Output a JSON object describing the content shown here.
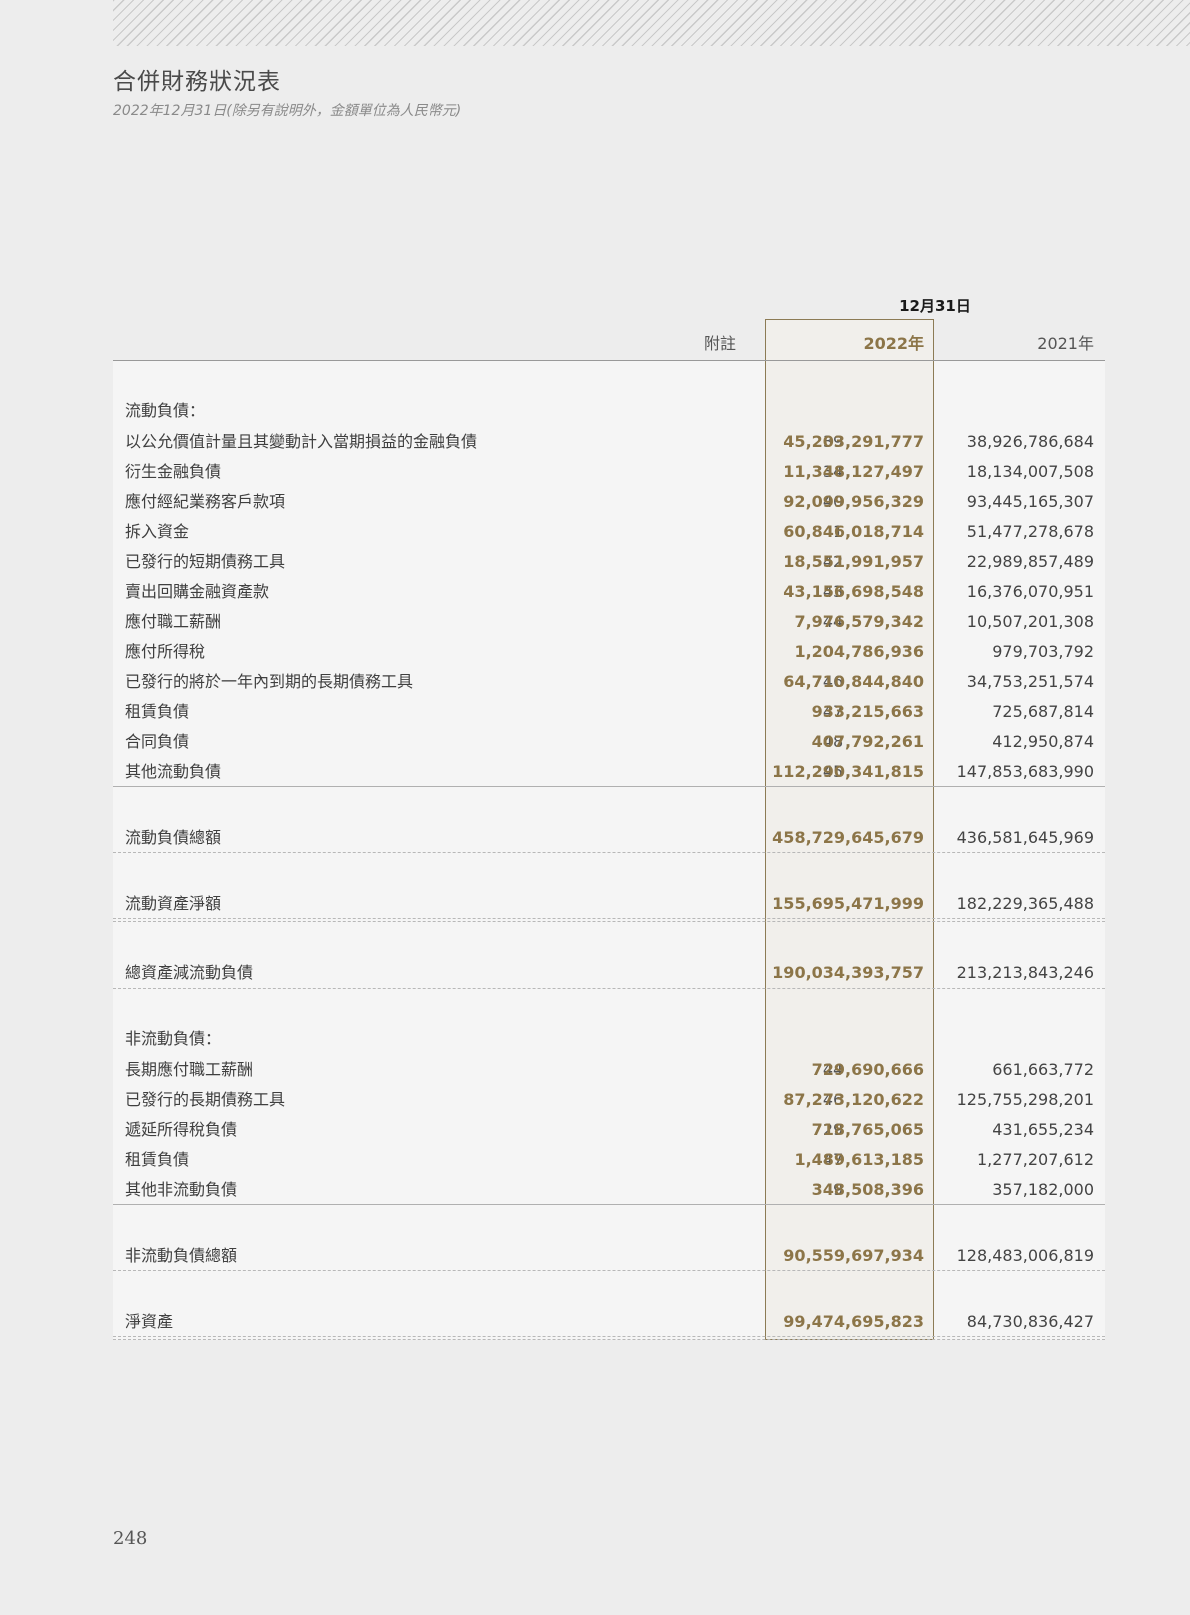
{
  "header": {
    "title": "合併財務狀況表",
    "subtitle": "2022年12月31日(除另有說明外，金額單位為人民幣元)"
  },
  "table": {
    "date_label": "12月31日",
    "note_header": "附註",
    "year_current": "2022年",
    "year_prior": "2021年",
    "current_liabilities_heading": "流動負債：",
    "current_liabilities": [
      {
        "label": "以公允價值計量且其變動計入當期損益的金融負債",
        "note": "39",
        "y2022": "45,203,291,777",
        "y2021": "38,926,786,684"
      },
      {
        "label": "衍生金融負債",
        "note": "34",
        "y2022": "11,348,127,497",
        "y2021": "18,134,007,508"
      },
      {
        "label": "應付經紀業務客戶款項",
        "note": "40",
        "y2022": "92,099,956,329",
        "y2021": "93,445,165,307"
      },
      {
        "label": "拆入資金",
        "note": "41",
        "y2022": "60,846,018,714",
        "y2021": "51,477,278,678"
      },
      {
        "label": "已發行的短期債務工具",
        "note": "42",
        "y2022": "18,551,991,957",
        "y2021": "22,989,857,489"
      },
      {
        "label": "賣出回購金融資產款",
        "note": "43",
        "y2022": "43,156,698,548",
        "y2021": "16,376,070,951"
      },
      {
        "label": "應付職工薪酬",
        "note": "44",
        "y2022": "7,976,579,342",
        "y2021": "10,507,201,308"
      },
      {
        "label": "應付所得稅",
        "note": "",
        "y2022": "1,204,786,936",
        "y2021": "979,703,792"
      },
      {
        "label": "已發行的將於一年內到期的長期債務工具",
        "note": "46",
        "y2022": "64,710,844,840",
        "y2021": "34,753,251,574"
      },
      {
        "label": "租賃負債",
        "note": "47",
        "y2022": "933,215,663",
        "y2021": "725,687,814"
      },
      {
        "label": "合同負債",
        "note": "48",
        "y2022": "407,792,261",
        "y2021": "412,950,874"
      },
      {
        "label": "其他流動負債",
        "note": "45",
        "y2022": "112,290,341,815",
        "y2021": "147,853,683,990"
      }
    ],
    "totals_a": [
      {
        "label": "流動負債總額",
        "y2022": "458,729,645,679",
        "y2021": "436,581,645,969"
      },
      {
        "label": "流動資產淨額",
        "y2022": "155,695,471,999",
        "y2021": "182,229,365,488"
      },
      {
        "label": "總資產減流動負債",
        "y2022": "190,034,393,757",
        "y2021": "213,213,843,246"
      }
    ],
    "non_current_liabilities_heading": "非流動負債：",
    "non_current_liabilities": [
      {
        "label": "長期應付職工薪酬",
        "note": "44",
        "y2022": "729,690,666",
        "y2021": "661,663,772"
      },
      {
        "label": "已發行的長期債務工具",
        "note": "46",
        "y2022": "87,273,120,622",
        "y2021": "125,755,298,201"
      },
      {
        "label": "遞延所得稅負債",
        "note": "29",
        "y2022": "718,765,065",
        "y2021": "431,655,234"
      },
      {
        "label": "租賃負債",
        "note": "47",
        "y2022": "1,489,613,185",
        "y2021": "1,277,207,612"
      },
      {
        "label": "其他非流動負債",
        "note": "49",
        "y2022": "348,508,396",
        "y2021": "357,182,000"
      }
    ],
    "totals_b": [
      {
        "label": "非流動負債總額",
        "y2022": "90,559,697,934",
        "y2021": "128,483,006,819"
      },
      {
        "label": "淨資產",
        "y2022": "99,474,695,823",
        "y2021": "84,730,836,427"
      }
    ]
  },
  "footer": {
    "page_number": "248"
  }
}
